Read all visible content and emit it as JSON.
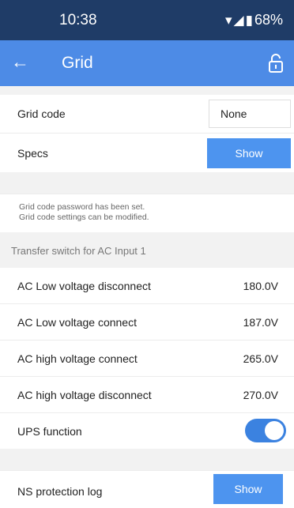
{
  "status_bar": {
    "time": "10:38",
    "wifi_icon": "▾",
    "signal_icon": "◢",
    "battery_icon": "▮",
    "battery_pct": "68%"
  },
  "app_bar": {
    "back_glyph": "←",
    "title": "Grid",
    "lock_icon": "lock-icon"
  },
  "grid_code": {
    "label": "Grid code",
    "value": "None"
  },
  "specs": {
    "label": "Specs",
    "button": "Show"
  },
  "notes": {
    "line1": "Grid code password has been set.",
    "line2": "Grid code settings can be modified."
  },
  "transfer_section": {
    "title": "Transfer switch for AC Input 1"
  },
  "settings": [
    {
      "label": "AC Low voltage disconnect",
      "value": "180.0V"
    },
    {
      "label": "AC Low voltage connect",
      "value": "187.0V"
    },
    {
      "label": "AC high voltage connect",
      "value": "265.0V"
    },
    {
      "label": "AC high voltage disconnect",
      "value": "270.0V"
    }
  ],
  "ups": {
    "label": "UPS function",
    "enabled": true
  },
  "ns_log": {
    "label": "NS protection log",
    "button": "Show"
  },
  "colors": {
    "status_bar": "#1f3c67",
    "app_bar": "#4d8be6",
    "accent": "#4d94ef",
    "toggle": "#3b82e0"
  }
}
